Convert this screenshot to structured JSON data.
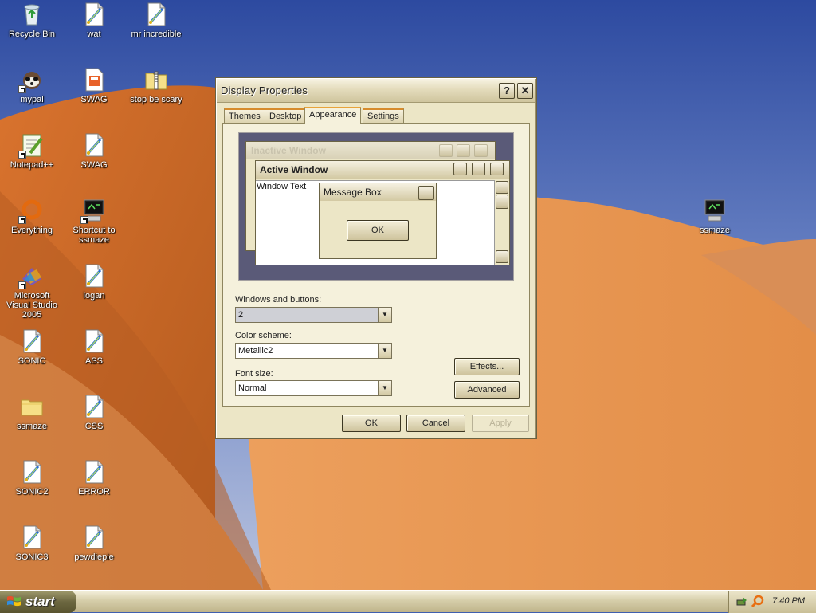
{
  "desktop": {
    "icons": [
      {
        "label": "Recycle Bin",
        "icon": "recycle-bin-icon"
      },
      {
        "label": "wat",
        "icon": "script-file-icon"
      },
      {
        "label": "mr incredible",
        "icon": "script-file-icon"
      },
      {
        "label": "mypal",
        "icon": "mypal-browser-icon"
      },
      {
        "label": "SWAG",
        "icon": "html-document-icon"
      },
      {
        "label": "stop be scary",
        "icon": "zip-folder-icon"
      },
      {
        "label": "Notepad++",
        "icon": "notepad-plus-plus-icon"
      },
      {
        "label": "SWAG",
        "icon": "script-file-icon"
      },
      {
        "label": "Everything",
        "icon": "everything-search-icon"
      },
      {
        "label": "Shortcut to ssmaze",
        "icon": "screensaver-monitor-icon"
      },
      {
        "label": "Microsoft Visual Studio 2005",
        "icon": "visual-studio-icon"
      },
      {
        "label": "logan",
        "icon": "script-file-icon"
      },
      {
        "label": "SONIC",
        "icon": "script-file-icon"
      },
      {
        "label": "ASS",
        "icon": "script-file-icon"
      },
      {
        "label": "ssmaze",
        "icon": "folder-icon"
      },
      {
        "label": "CSS",
        "icon": "script-file-icon"
      },
      {
        "label": "SONIC2",
        "icon": "script-file-icon"
      },
      {
        "label": "ERROR",
        "icon": "script-file-icon"
      },
      {
        "label": "SONIC3",
        "icon": "script-file-icon"
      },
      {
        "label": "pewdiepie",
        "icon": "script-file-icon"
      },
      {
        "label": "ssmaze",
        "icon": "screensaver-monitor-icon"
      }
    ]
  },
  "dialog": {
    "title": "Display Properties",
    "help_label": "?",
    "close_label": "✕",
    "tabs": [
      "Themes",
      "Desktop",
      "Appearance",
      "Settings"
    ],
    "active_tab": "Appearance",
    "preview": {
      "inactive_title": "Inactive Window",
      "active_title": "Active Window",
      "window_text": "Window Text",
      "message_title": "Message Box",
      "ok_label": "OK"
    },
    "windows_buttons_label": "Windows and buttons:",
    "windows_buttons_value": "2",
    "color_scheme_label": "Color scheme:",
    "color_scheme_value": "Metallic2",
    "font_size_label": "Font size:",
    "font_size_value": "Normal",
    "effects_label": "Effects...",
    "advanced_label": "Advanced",
    "ok_label": "OK",
    "cancel_label": "Cancel",
    "apply_label": "Apply"
  },
  "taskbar": {
    "start_label": "start",
    "clock": "7:40 PM"
  },
  "colors": {
    "sky": "#3f5fb0",
    "dune": "#e08a3c",
    "dialog_face": "#ece6c6",
    "tab_accent": "#e8a33a"
  }
}
